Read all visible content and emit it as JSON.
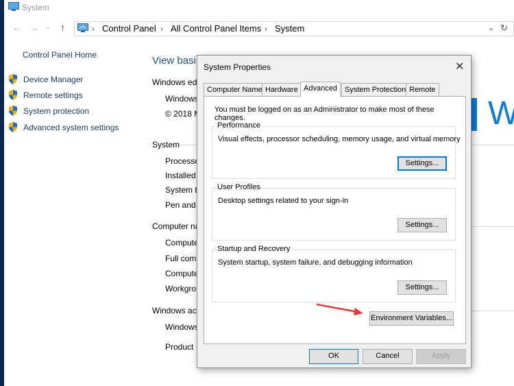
{
  "window": {
    "title": "System"
  },
  "address_bar": {
    "breadcrumbs": [
      "Control Panel",
      "All Control Panel Items",
      "System"
    ]
  },
  "left_nav": {
    "home": "Control Panel Home",
    "tasks": [
      "Device Manager",
      "Remote settings",
      "System protection",
      "Advanced system settings"
    ]
  },
  "main": {
    "heading": "View basi",
    "edition_header": "Windows edi",
    "edition_lines": [
      "Windows",
      "© 2018 M"
    ],
    "system_header": "System",
    "system_lines": [
      "Processo",
      "Installed",
      "System ty",
      "Pen and"
    ],
    "computer_header": "Computer na",
    "computer_lines": [
      "Compute",
      "Full com",
      "Compute",
      "Workgro"
    ],
    "activation_header": "Windows act",
    "activation_lines": [
      "Windows",
      "Product"
    ],
    "logo_text": "W"
  },
  "dialog": {
    "title": "System Properties",
    "close": "✕",
    "tabs": [
      "Computer Name",
      "Hardware",
      "Advanced",
      "System Protection",
      "Remote"
    ],
    "active_tab": "Advanced",
    "admin_note": "You must be logged on as an Administrator to make most of these changes.",
    "performance": {
      "title": "Performance",
      "desc": "Visual effects, processor scheduling, memory usage, and virtual memory",
      "button": "Settings..."
    },
    "profiles": {
      "title": "User Profiles",
      "desc": "Desktop settings related to your sign-in",
      "button": "Settings..."
    },
    "startup": {
      "title": "Startup and Recovery",
      "desc": "System startup, system failure, and debugging information",
      "button": "Settings..."
    },
    "env_button": "Environment Variables...",
    "ok": "OK",
    "cancel": "Cancel",
    "apply": "Apply"
  },
  "colors": {
    "accent": "#0078d7",
    "annotation_arrow": "#e53935",
    "link": "#1a3d6e"
  }
}
